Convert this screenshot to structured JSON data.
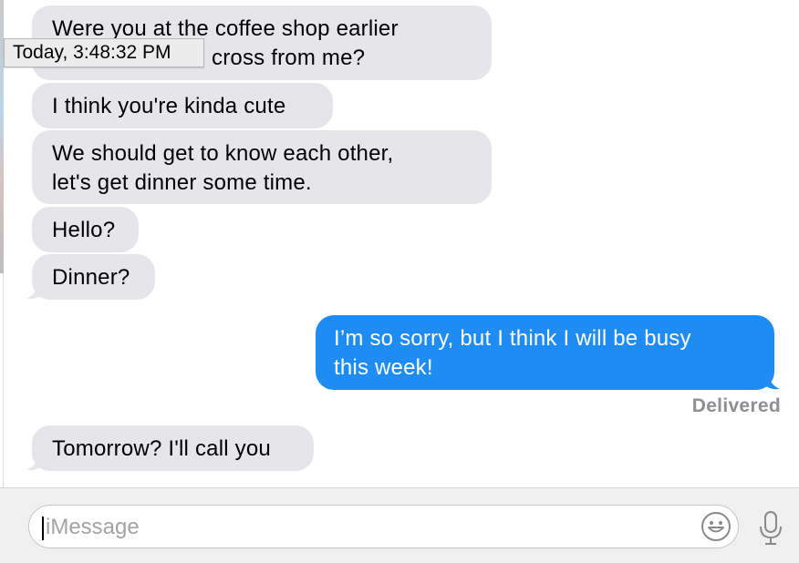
{
  "transcript": {
    "messages": [
      {
        "direction": "incoming",
        "lines": [
          "Were you at the coffee shop earlier",
          "... sitting across from me?"
        ]
      },
      {
        "direction": "incoming",
        "lines": [
          "I think you're kinda cute"
        ]
      },
      {
        "direction": "incoming",
        "lines": [
          "We should get to know each other,",
          "let's get dinner some time."
        ]
      },
      {
        "direction": "incoming",
        "lines": [
          "Hello?"
        ]
      },
      {
        "direction": "incoming",
        "lines": [
          "Dinner?"
        ]
      },
      {
        "direction": "outgoing",
        "lines": [
          "I’m so sorry, but I think I will be busy",
          "this week!"
        ]
      },
      {
        "direction": "incoming",
        "lines": [
          "Tomorrow? I'll call you"
        ]
      }
    ],
    "first_message_visible_line2": "cross from me?",
    "timestamp_tooltip": "Today, 3:48:32 PM",
    "delivery_status": "Delivered"
  },
  "compose": {
    "placeholder": "iMessage",
    "emoji_icon": "smiley-icon",
    "mic_icon": "microphone-icon"
  },
  "colors": {
    "incoming_bubble": "#e5e5ea",
    "outgoing_bubble": "#1f8cf4",
    "status_text": "#8e8e93"
  }
}
